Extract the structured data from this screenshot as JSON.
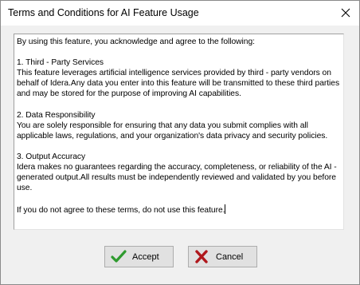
{
  "window": {
    "title": "Terms and Conditions for AI Feature Usage"
  },
  "terms": {
    "text": "By using this feature, you acknowledge and agree to the following:\n\n1. Third - Party Services\nThis feature leverages artificial intelligence services provided by third - party vendors on behalf of Idera.Any data you enter into this feature will be transmitted to these third parties and may be stored for the purpose of improving AI capabilities.\n\n2. Data Responsibility\nYou are solely responsible for ensuring that any data you submit complies with all applicable laws, regulations, and your organization's data privacy and security policies.\n\n3. Output Accuracy\nIdera makes no guarantees regarding the accuracy, completeness, or reliability of the AI - generated output.All results must be independently reviewed and validated by you before use.\n\nIf you do not agree to these terms, do not use this feature."
  },
  "buttons": {
    "accept_label": "Accept",
    "cancel_label": "Cancel"
  },
  "icons": {
    "close": "close-icon",
    "accept": "checkmark-icon",
    "cancel": "x-icon"
  },
  "colors": {
    "accept_icon": "#2e9a2e",
    "cancel_icon": "#b0171c"
  }
}
